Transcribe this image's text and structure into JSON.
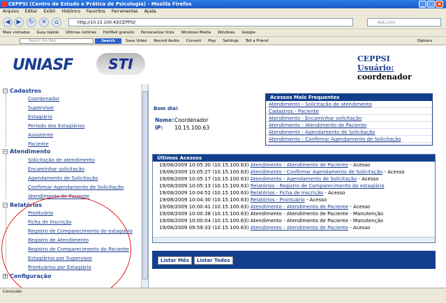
{
  "window": {
    "title": "CEPPSI (Centro de Estudo e Prática de Psicologia) - Mozilla Firefox"
  },
  "menubar": [
    "Arquivo",
    "Editar",
    "Exibir",
    "Histórico",
    "Favoritos",
    "Ferramentas",
    "Ajuda"
  ],
  "navbar": {
    "url": "http://10.15.100.43/CEPPSI/",
    "search_placeholder": "Ask.com"
  },
  "bookmarks": [
    "Mais visitados",
    "Guia rápido",
    "Últimas notícias",
    "HotMail gratuito",
    "Personalizar links",
    "Windows Media",
    "Windows",
    "Google"
  ],
  "toolbar": {
    "search_placeholder": "Search the Web",
    "search_button": "Search",
    "items": [
      "Save Video",
      "Record Audio",
      "Convert",
      "Play",
      "Settings",
      "Tell a Friend"
    ],
    "options": "Options"
  },
  "header": {
    "logo_left": "UNIASF",
    "logo_right": "STI",
    "org": "CEPPSI",
    "user_label": "Usuário:",
    "user_name": "coordenador"
  },
  "sidebar": {
    "sections": [
      {
        "title": "Cadastros",
        "items": [
          "Coordenador",
          "Supervisor",
          "Estagiário",
          "Período dos Estagiários",
          "Assistente",
          "Paciente"
        ]
      },
      {
        "title": "Atendimento",
        "items": [
          "Solicitação de atendimento",
          "Encaminhar solicitação",
          "Agendamento de Solicitação",
          "Confirmar Agendamento de Solicitação",
          "Atendimento de Paciente"
        ]
      },
      {
        "title": "Relatórios",
        "items": [
          "Prontuário",
          "Ficha de Inscrição",
          "Registro de Comparecimento do estagiário",
          "Registro de Atendimento",
          "Registro de Comparecimento do Paciente",
          "Estagiários por Supervisor",
          "Prontuários por Estagiário"
        ]
      },
      {
        "title": "Configuração",
        "items": []
      }
    ]
  },
  "main": {
    "welcome": "Bom dia!",
    "name_label": "Nome:",
    "name_value": "Coordenador",
    "ip_label": "IP:",
    "ip_value": "10.15.100.63",
    "frequent_title": "Acessos Mais Frequentes",
    "frequent": [
      "Atendimento - Solicitação de atendimento",
      "Cadastros - Paciente",
      "Atendimento - Encaminhar solicitação",
      "Atendimento - Atendimento de Paciente",
      "Atendimento - Agendamento de Solicitação",
      "Atendimento - Confirmar Agendamento de Solicitação"
    ],
    "recent_title": "Últimos Acessos",
    "recent": [
      {
        "ts": "19/08/2009 10:05:30 (10.15.100.63)",
        "link": "Atendimento - Atendimento de Paciente",
        "action": "Acesso"
      },
      {
        "ts": "19/08/2009 10:05:27 (10.15.100.63)",
        "link": "Atendimento - Confirmar Agendamento de Solicitação",
        "action": "Acesso"
      },
      {
        "ts": "19/08/2009 10:05:17 (10.15.100.63)",
        "link": "Atendimento - Agendamento de Solicitação",
        "action": "Acesso"
      },
      {
        "ts": "19/08/2009 10:05:13 (10.15.100.63)",
        "link": "Relatórios - Registro de Comparecimento do estagiário",
        "action": ""
      },
      {
        "ts": "19/08/2009 10:04:52 (10.15.100.63)",
        "link": "Relatórios - Ficha de Inscrição",
        "action": "Acesso"
      },
      {
        "ts": "19/08/2009 10:04:30 (10.15.100.63)",
        "link": "Relatórios - Prontuário",
        "action": "Acesso"
      },
      {
        "ts": "19/08/2009 10:00:41 (10.15.100.63)",
        "link": "Atendimento - Atendimento de Paciente",
        "action": "Acesso"
      },
      {
        "ts": "19/08/2009 10:00:38 (10.15.100.63)",
        "link": "",
        "action": "Atendimento - Atendimento de Paciente - Manutenção"
      },
      {
        "ts": "19/08/2009 10:00:04 (10.15.100.63)",
        "link": "",
        "action": "Atendimento - Atendimento de Paciente - Manutenção"
      },
      {
        "ts": "19/08/2009 09:59:33 (10.15.100.63)",
        "link": "Atendimento - Atendimento de Paciente",
        "action": "Acesso"
      }
    ],
    "btn_month": "Listar Mês",
    "btn_all": "Listar Todos"
  },
  "status": "Concluído"
}
